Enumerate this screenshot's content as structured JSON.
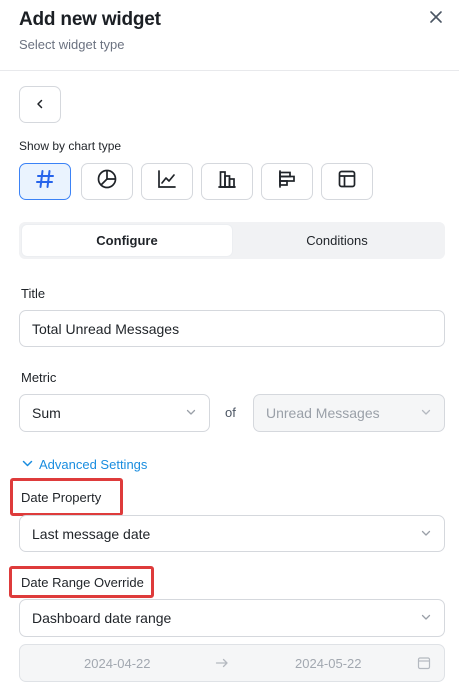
{
  "header": {
    "title": "Add new widget",
    "subtitle": "Select widget type"
  },
  "icons": {
    "close": "close-icon",
    "back": "chevron-left-icon",
    "chevron": "chevron-down-icon",
    "calendar": "calendar-icon",
    "arrow": "arrow-right-icon"
  },
  "chart_type": {
    "label": "Show by chart type",
    "options": [
      {
        "name": "number",
        "icon": "hash-icon",
        "selected": true
      },
      {
        "name": "pie",
        "icon": "pie-chart-icon",
        "selected": false
      },
      {
        "name": "line",
        "icon": "line-chart-icon",
        "selected": false
      },
      {
        "name": "column",
        "icon": "column-chart-icon",
        "selected": false
      },
      {
        "name": "bar",
        "icon": "bar-chart-icon",
        "selected": false
      },
      {
        "name": "table",
        "icon": "table-icon",
        "selected": false
      }
    ]
  },
  "tabs": [
    {
      "label": "Configure",
      "active": true
    },
    {
      "label": "Conditions",
      "active": false
    }
  ],
  "form": {
    "title_label": "Title",
    "title_value": "Total Unread Messages",
    "metric_label": "Metric",
    "metric_aggregation": "Sum",
    "of_label": "of",
    "metric_field": "Unread Messages",
    "advanced_settings": "Advanced Settings",
    "date_property_label": "Date Property",
    "date_property_value": "Last message date",
    "date_range_label": "Date Range Override",
    "date_range_value": "Dashboard date range",
    "date_start": "2024-04-22",
    "date_end": "2024-05-22"
  },
  "colors": {
    "accent": "#1a8ddf",
    "selected_bg": "#eaf3fe",
    "selected_border": "#3b82f6",
    "highlight": "#de3b3b"
  }
}
